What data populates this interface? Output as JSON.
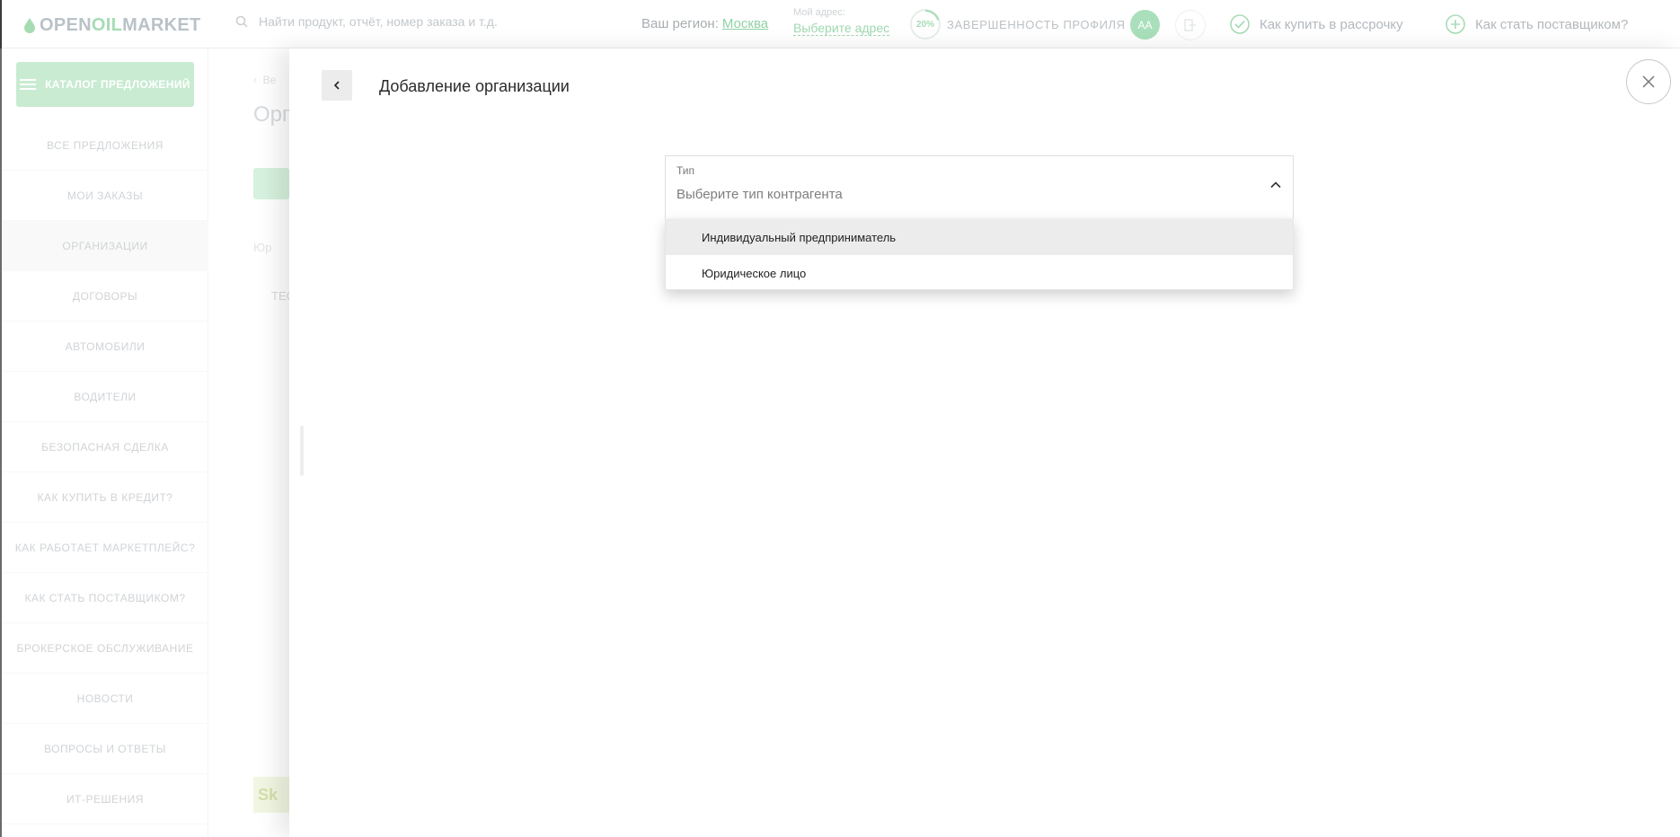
{
  "header": {
    "logo": {
      "part1": "OPEN",
      "part2": "OIL",
      "part3": "MARKET"
    },
    "search_placeholder": "Найти продукт, отчёт, номер заказа и т.д.",
    "region_label": "Ваш регион:",
    "region_value": "Москва",
    "address_label": "Мой адрес:",
    "address_link": "Выберите адрес",
    "profile_progress": "20%",
    "profile_progress_value": 0.2,
    "profile_label": "ЗАВЕРШЕННОСТЬ ПРОФИЛЯ",
    "avatar_initials": "АА",
    "installment_link": "Как купить в рассрочку",
    "supplier_link": "Как стать поставщиком?"
  },
  "sidebar": {
    "catalog_button": "КАТАЛОГ ПРЕДЛОЖЕНИЙ",
    "items": [
      "ВСЕ ПРЕДЛОЖЕНИЯ",
      "МОИ ЗАКАЗЫ",
      "ОРГАНИЗАЦИИ",
      "ДОГОВОРЫ",
      "АВТОМОБИЛИ",
      "ВОДИТЕЛИ",
      "БЕЗОПАСНАЯ СДЕЛКА",
      "КАК КУПИТЬ В КРЕДИТ?",
      "КАК РАБОТАЕТ МАРКЕТПЛЕЙС?",
      "КАК СТАТЬ ПОСТАВЩИКОМ?",
      "БРОКЕРСКОЕ ОБСЛУЖИВАНИЕ",
      "НОВОСТИ",
      "ВОПРОСЫ И ОТВЕТЫ",
      "ИТ-РЕШЕНИЯ"
    ],
    "active_item": "ОРГАНИЗАЦИИ"
  },
  "background_content": {
    "breadcrumb": "Ве",
    "title": "Орга",
    "add_button": "+",
    "table_header": "Юр",
    "table_cell": "ТЕС",
    "partner_logo": "Sk"
  },
  "modal": {
    "title": "Добавление организации",
    "field_label": "Тип",
    "field_placeholder": "Выберите тип контрагента",
    "options": [
      "Индивидуальный предприниматель",
      "Юридическое лицо"
    ],
    "highlighted_option": "Индивидуальный предприниматель"
  },
  "colors": {
    "brand_green": "#3cba5f",
    "overlay_tint": "rgba(255,255,255,0.6)"
  }
}
